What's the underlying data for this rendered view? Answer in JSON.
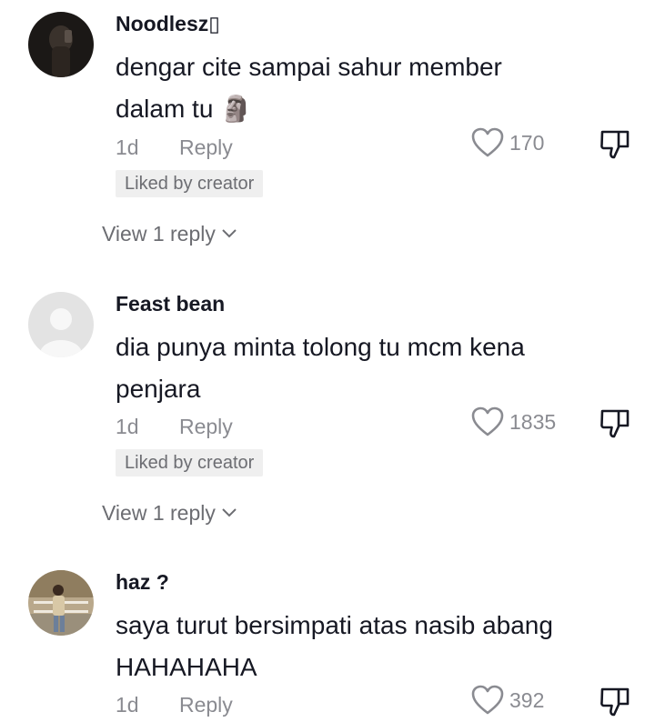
{
  "comments": [
    {
      "username": "Noodlesz▯",
      "text_line1": "dengar cite sampai sahur member",
      "text_line2": "dalam tu 🗿",
      "time": "1d",
      "reply_label": "Reply",
      "likes": "170",
      "badge": "Liked by creator",
      "view_replies": "View 1 reply",
      "avatar_icon": "dark-photo-avatar"
    },
    {
      "username": "Feast bean",
      "text_line1": "dia punya minta tolong tu mcm kena",
      "text_line2": "penjara",
      "time": "1d",
      "reply_label": "Reply",
      "likes": "1835",
      "badge": "Liked by creator",
      "view_replies": "View 1 reply",
      "avatar_icon": "default-person-avatar"
    },
    {
      "username": "haz ?",
      "text_line1": "saya turut bersimpati atas nasib abang",
      "text_line2": "HAHAHAHA",
      "time": "1d",
      "reply_label": "Reply",
      "likes": "392",
      "avatar_icon": "outdoor-photo-avatar"
    }
  ],
  "icons": {
    "like": "heart-outline-icon",
    "dislike": "thumbs-down-icon",
    "expand": "chevron-down-icon"
  },
  "colors": {
    "text": "#161823",
    "muted": "#8a8b91",
    "badge_bg": "#efefef"
  }
}
